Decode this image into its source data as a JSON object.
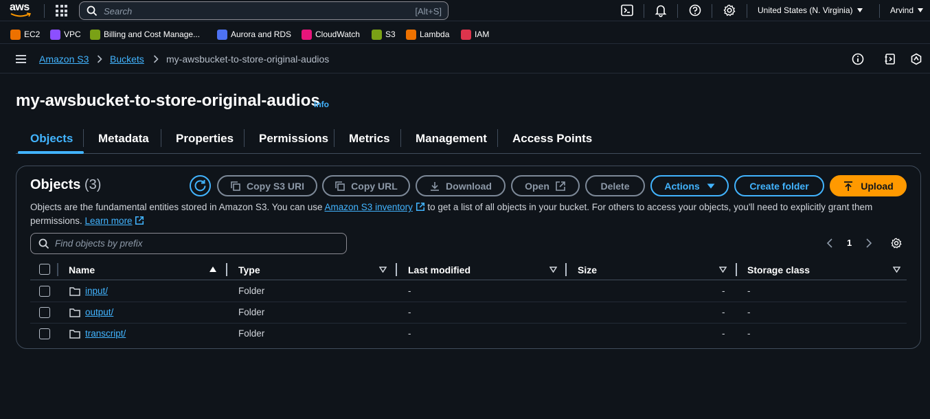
{
  "topbar": {
    "logo_text": "aws",
    "search_placeholder": "Search",
    "search_shortcut": "[Alt+S]",
    "region": "United States (N. Virginia)",
    "user": "Arvind"
  },
  "favorites": [
    {
      "label": "EC2",
      "color": "#ed7100"
    },
    {
      "label": "VPC",
      "color": "#8c4fff"
    },
    {
      "label": "Billing and Cost Manage...",
      "color": "#7aa116"
    },
    {
      "label": "Aurora and RDS",
      "color": "#4d72f3"
    },
    {
      "label": "CloudWatch",
      "color": "#e7157b"
    },
    {
      "label": "S3",
      "color": "#7aa116"
    },
    {
      "label": "Lambda",
      "color": "#ed7100"
    },
    {
      "label": "IAM",
      "color": "#dd344c"
    }
  ],
  "breadcrumb": {
    "items": [
      "Amazon S3",
      "Buckets",
      "my-awsbucket-to-store-original-audios"
    ]
  },
  "page": {
    "title": "my-awsbucket-to-store-original-audios",
    "info": "Info"
  },
  "tabs": [
    "Objects",
    "Metadata",
    "Properties",
    "Permissions",
    "Metrics",
    "Management",
    "Access Points"
  ],
  "panel": {
    "title": "Objects",
    "count": "(3)",
    "buttons": {
      "copy_uri": "Copy S3 URI",
      "copy_url": "Copy URL",
      "download": "Download",
      "open": "Open",
      "delete": "Delete",
      "actions": "Actions",
      "create_folder": "Create folder",
      "upload": "Upload"
    },
    "desc_1": "Objects are the fundamental entities stored in Amazon S3. You can use ",
    "desc_link": "Amazon S3 inventory",
    "desc_2": " to get a list of all objects in your bucket. For others to access your objects, you'll need to explicitly grant them permissions. ",
    "learn_more": "Learn more",
    "filter_placeholder": "Find objects by prefix",
    "page_number": "1"
  },
  "table": {
    "headers": [
      "Name",
      "Type",
      "Last modified",
      "Size",
      "Storage class"
    ],
    "rows": [
      {
        "name": "input/",
        "type": "Folder",
        "modified": "-",
        "size": "-",
        "storage": "-"
      },
      {
        "name": "output/",
        "type": "Folder",
        "modified": "-",
        "size": "-",
        "storage": "-"
      },
      {
        "name": "transcript/",
        "type": "Folder",
        "modified": "-",
        "size": "-",
        "storage": "-"
      }
    ]
  },
  "colors": {
    "accent": "#42b4ff",
    "upload": "#ff9900",
    "background": "#0f141a"
  }
}
